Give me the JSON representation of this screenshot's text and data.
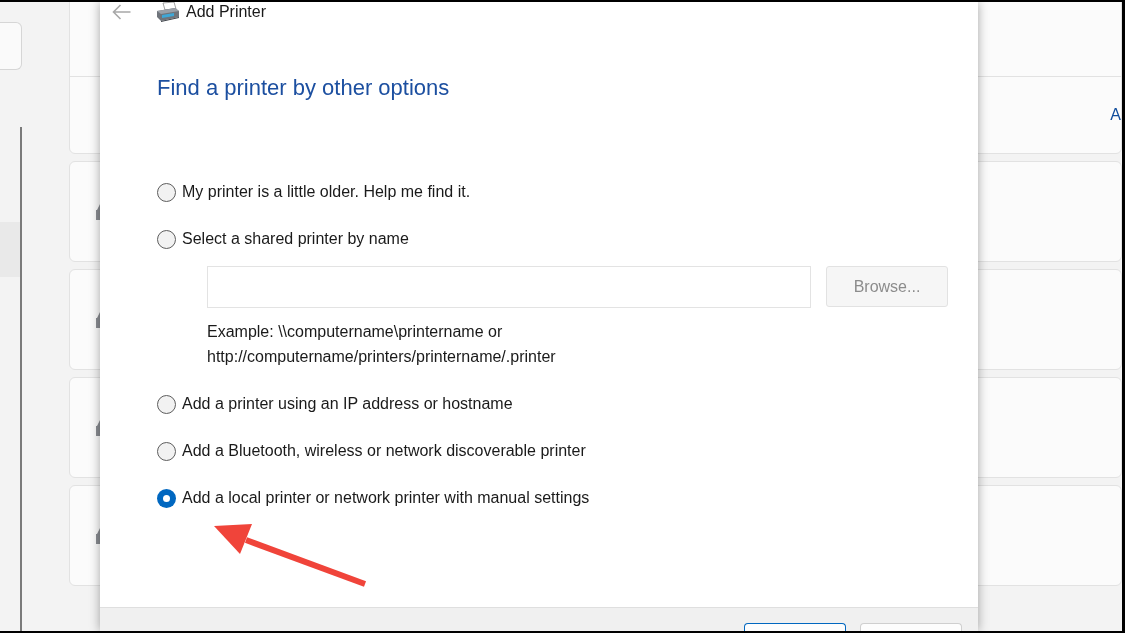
{
  "settings_window": {
    "card_text": "A"
  },
  "dialog": {
    "back_button": {
      "disabled": true
    },
    "title": "Add Printer",
    "heading": "Find a printer by other options",
    "options": [
      {
        "label": "My printer is a little older. Help me find it.",
        "selected": false
      },
      {
        "label": "Select a shared printer by name",
        "selected": false,
        "details": {
          "browse_button": {
            "label": "Browse...",
            "disabled": true
          },
          "example": "Example: \\\\computername\\printername or http://computername/printers/printername/.printer"
        }
      },
      {
        "label": "Add a printer using an IP address or hostname",
        "selected": false
      },
      {
        "label": "Add a Bluetooth, wireless or network discoverable printer",
        "selected": false
      },
      {
        "label": "Add a local printer or network printer with manual settings",
        "selected": true
      }
    ],
    "footer_buttons": [
      {
        "focused": true
      },
      {
        "focused": false
      }
    ]
  }
}
